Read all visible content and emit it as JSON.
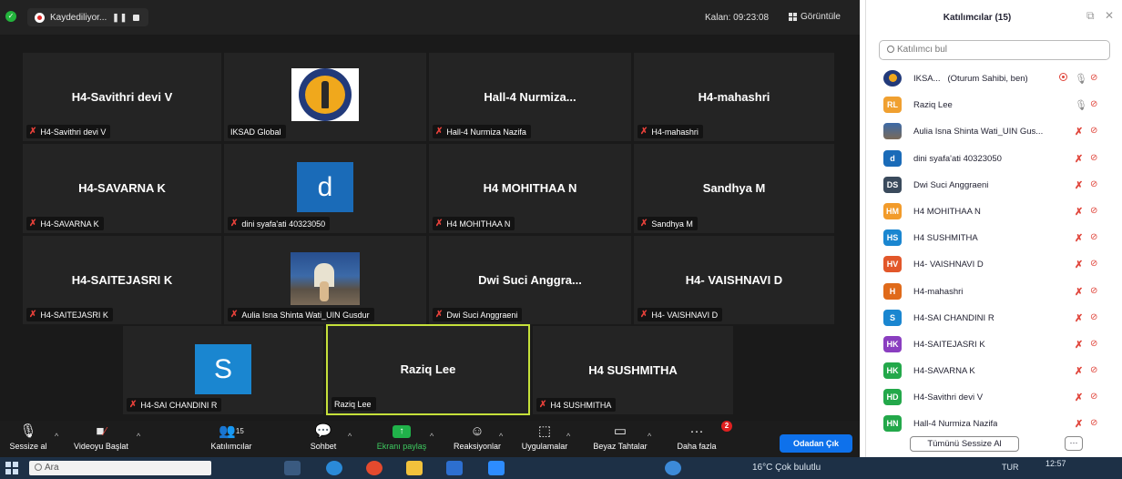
{
  "topbar": {
    "recording_label": "Kaydediliyor...",
    "pause_symbol": "❚❚",
    "remaining": "Kalan: 09:23:08",
    "view_label": "Görüntüle"
  },
  "tiles": [
    {
      "title": "H4-Savithri devi V",
      "label": "H4-Savithri devi V",
      "muted": true
    },
    {
      "title": "",
      "label": "IKSAD Global",
      "muted": false,
      "media": "logo"
    },
    {
      "title": "Hall-4  Nurmiza...",
      "label": "Hall-4 Nurmiza Nazifa",
      "muted": true
    },
    {
      "title": "H4-mahashri",
      "label": "H4-mahashri",
      "muted": true
    },
    {
      "title": "H4-SAVARNA K",
      "label": "H4-SAVARNA K",
      "muted": true
    },
    {
      "title": "",
      "label": "dini syafa'ati 40323050",
      "muted": true,
      "media": "avatar",
      "avatar_letter": "d",
      "avatar_color": "#1a6bb8"
    },
    {
      "title": "H4 MOHITHAA N",
      "label": "H4 MOHITHAA N",
      "muted": true
    },
    {
      "title": "Sandhya M",
      "label": "Sandhya M",
      "muted": true
    },
    {
      "title": "H4-SAITEJASRI K",
      "label": "H4-SAITEJASRI K",
      "muted": true
    },
    {
      "title": "",
      "label": "Aulia Isna Shinta Wati_UIN Gusdur",
      "muted": true,
      "media": "photo"
    },
    {
      "title": "Dwi Suci Anggra...",
      "label": "Dwi Suci Anggraeni",
      "muted": true
    },
    {
      "title": "H4- VAISHNAVI D",
      "label": "H4- VAISHNAVI D",
      "muted": true
    },
    {
      "title": "",
      "label": "H4-SAI CHANDINI R",
      "muted": true,
      "media": "avatar",
      "avatar_letter": "S",
      "avatar_color": "#1a86d0"
    },
    {
      "title": "Raziq Lee",
      "label": "Raziq Lee",
      "muted": false,
      "active": true
    },
    {
      "title": "H4 SUSHMITHA",
      "label": "H4 SUSHMITHA",
      "muted": true
    }
  ],
  "toolbar": {
    "mute": "Sessize al",
    "video": "Videoyu Başlat",
    "participants": "Katılımcılar",
    "participants_count": "15",
    "chat": "Sohbet",
    "share": "Ekranı paylaş",
    "reactions": "Reaksiyonlar",
    "apps": "Uygulamalar",
    "whiteboard": "Beyaz Tahtalar",
    "more": "Daha fazla",
    "more_badge": "2",
    "leave": "Odadan Çık"
  },
  "taskbar": {
    "search_placeholder": "Ara",
    "weather": "16°C  Çok bulutlu",
    "lang": "TUR",
    "time": "12:57"
  },
  "panel": {
    "title": "Katılımcılar (15)",
    "search_placeholder": "Katılımcı bul",
    "participants": [
      {
        "initials": "",
        "name": "IKSA...",
        "role": "(Oturum Sahibi, ben)",
        "color": "#f0a81c",
        "mic_on": true,
        "recording": true,
        "logo": true
      },
      {
        "initials": "RL",
        "name": "Raziq Lee",
        "color": "#f0a030",
        "mic_on": true
      },
      {
        "initials": "",
        "name": "Aulia Isna Shinta Wati_UIN Gus...",
        "color": "#5a7aa8",
        "mic_on": false,
        "photo": true
      },
      {
        "initials": "d",
        "name": "dini syafa'ati 40323050",
        "color": "#1a6bb8",
        "mic_on": false
      },
      {
        "initials": "DS",
        "name": "Dwi Suci Anggraeni",
        "color": "#3a4a5c",
        "mic_on": false
      },
      {
        "initials": "HM",
        "name": "H4 MOHITHAA N",
        "color": "#f29b2a",
        "mic_on": false
      },
      {
        "initials": "HS",
        "name": "H4 SUSHMITHA",
        "color": "#1a86d0",
        "mic_on": false
      },
      {
        "initials": "HV",
        "name": "H4- VAISHNAVI D",
        "color": "#e2572a",
        "mic_on": false
      },
      {
        "initials": "H",
        "name": "H4-mahashri",
        "color": "#e06a1a",
        "mic_on": false
      },
      {
        "initials": "S",
        "name": "H4-SAI CHANDINI R",
        "color": "#1a86d0",
        "mic_on": false
      },
      {
        "initials": "HK",
        "name": "H4-SAITEJASRI K",
        "color": "#8a3ec0",
        "mic_on": false
      },
      {
        "initials": "HK",
        "name": "H4-SAVARNA K",
        "color": "#23a84a",
        "mic_on": false
      },
      {
        "initials": "HD",
        "name": "H4-Savithri devi V",
        "color": "#23a84a",
        "mic_on": false
      },
      {
        "initials": "HN",
        "name": "Hall-4 Nurmiza Nazifa",
        "color": "#23a84a",
        "mic_on": false
      }
    ],
    "mute_all": "Tümünü Sessize Al",
    "more": "···"
  }
}
